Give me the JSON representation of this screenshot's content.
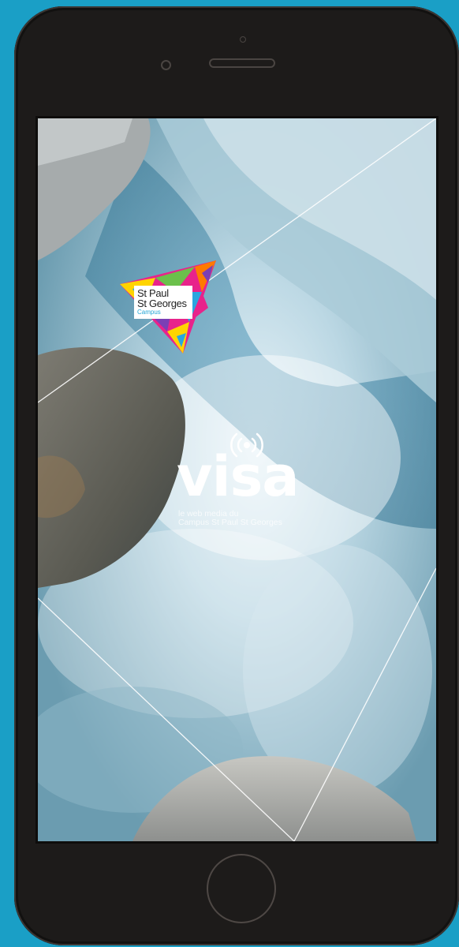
{
  "colors": {
    "background": "#1a9fc6",
    "device_body": "#1d1b1a",
    "screen_water": "#6f9fb3",
    "campus_accent": "#23a6d6",
    "visa_text": "#ffffff"
  },
  "device": {
    "home_button_icon": "home-button-ring"
  },
  "splash": {
    "campus_logo": {
      "line1": "St Paul",
      "line2": "St Georges",
      "sub": "Campus"
    },
    "visa": {
      "icon": "broadcast-icon",
      "wordmark": "visa",
      "tagline_line1": "le web media du",
      "tagline_line2": "Campus St Paul St Georges"
    }
  }
}
